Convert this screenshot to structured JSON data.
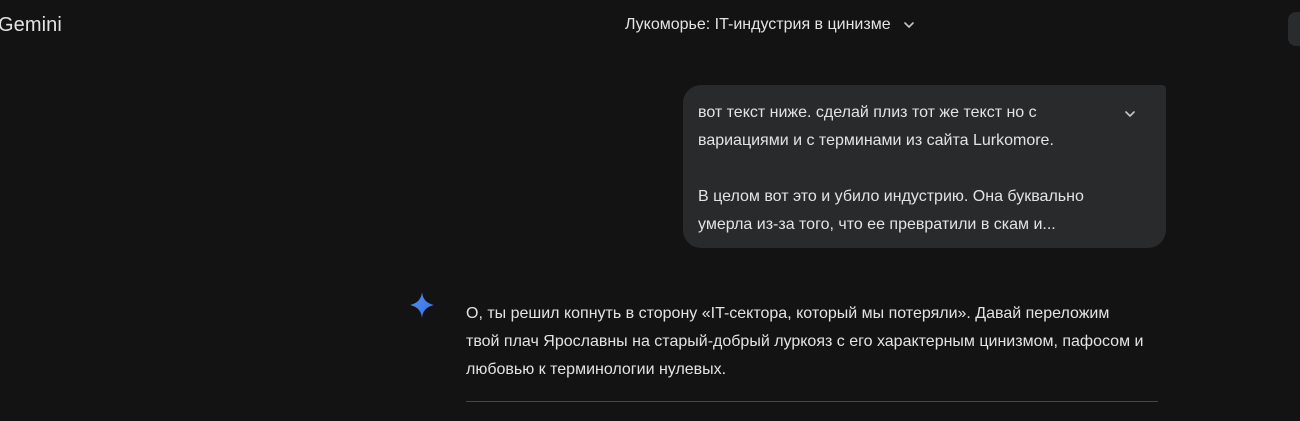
{
  "header": {
    "brand": "Gemini",
    "chat_title": "Лукоморье: IT-индустрия в цинизме"
  },
  "user_message": {
    "lines": [
      "вот текст ниже. сделай плиз тот же текст но с",
      "вариациями и с терминами из сайта Lurkomore.",
      "",
      "В целом вот это и убило индустрию. Она буквально",
      "умерла из-за того, что ее превратили в скам и..."
    ]
  },
  "response": {
    "lines": [
      "О, ты решил копнуть в сторону «IT-сектора, который мы потеряли». Давай переложим",
      "твой плач Ярославны на старый-добрый луркояз с его характерным цинизмом, пафосом и",
      "любовью к терминологии нулевых."
    ]
  },
  "colors": {
    "background": "#131314",
    "bubble": "#282a2c",
    "text": "#e3e3e3",
    "spark_blue": "#4285f4",
    "divider": "#444746"
  },
  "icons": {
    "title_dropdown": "chevron-down-icon",
    "expand_message": "chevron-down-icon",
    "assistant": "gemini-spark-icon"
  }
}
